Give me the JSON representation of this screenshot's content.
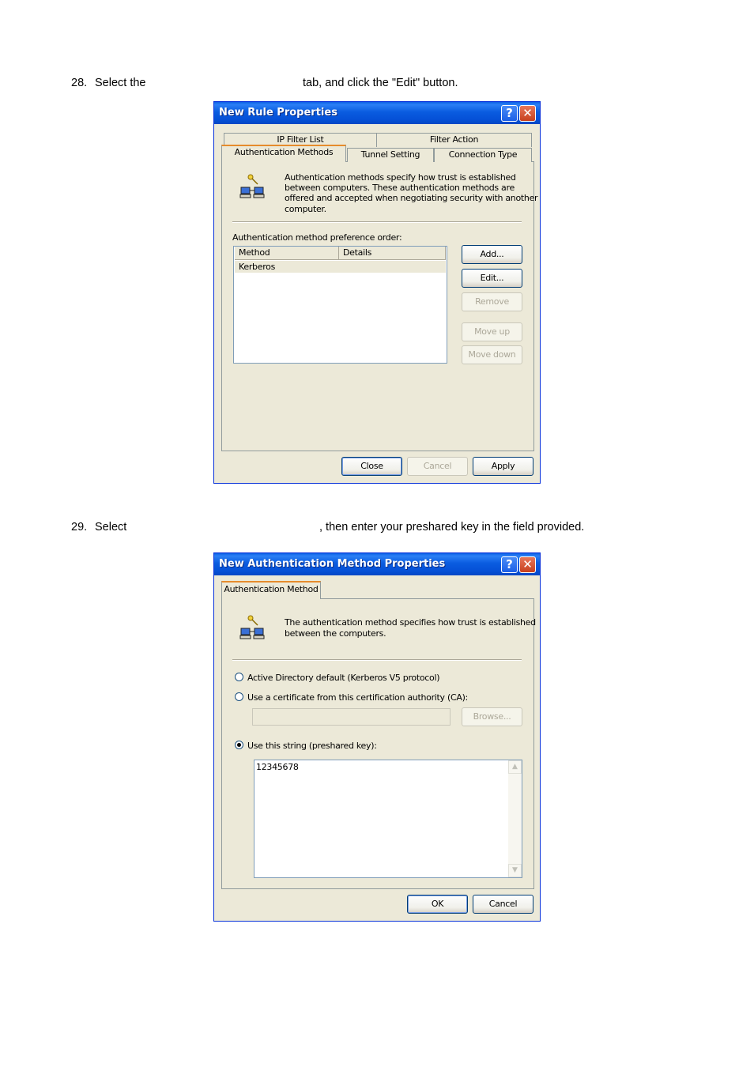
{
  "step28": {
    "number": "28.",
    "text_before": "Select the",
    "text_after": "tab, and click the \"Edit\" button."
  },
  "dialog1": {
    "title": "New Rule Properties",
    "tabs_row1": [
      "IP Filter List",
      "Filter Action"
    ],
    "tabs_row2": [
      "Authentication Methods",
      "Tunnel Setting",
      "Connection Type"
    ],
    "description": "Authentication methods specify how trust is established between computers. These authentication methods are offered and accepted when negotiating security with another computer.",
    "desc_lines": [
      "Authentication methods specify how trust is established",
      "between computers. These authentication methods are",
      "offered and accepted when negotiating security with another",
      "computer."
    ],
    "list_label": "Authentication method preference order:",
    "columns": [
      "Method",
      "Details"
    ],
    "rows": [
      {
        "method": "Kerberos",
        "details": ""
      }
    ],
    "buttons": {
      "add": "Add...",
      "edit": "Edit...",
      "remove": "Remove",
      "move_up": "Move up",
      "move_down": "Move down"
    },
    "footer": {
      "close": "Close",
      "cancel": "Cancel",
      "apply": "Apply"
    }
  },
  "step29": {
    "number": "29.",
    "text_before": "Select",
    "text_after": ", then enter your preshared key in the field provided."
  },
  "dialog2": {
    "title": "New Authentication Method Properties",
    "tab": "Authentication Method",
    "desc_lines": [
      "The authentication method specifies how trust is established",
      "between the computers."
    ],
    "options": {
      "kerberos": "Active Directory default (Kerberos V5 protocol)",
      "certificate": "Use a certificate from this certification authority (CA):",
      "preshared": "Use this string (preshared key):"
    },
    "selected_option": "preshared",
    "ca_value": "",
    "browse": "Browse...",
    "preshared_value": "12345678",
    "footer": {
      "ok": "OK",
      "cancel": "Cancel"
    }
  }
}
